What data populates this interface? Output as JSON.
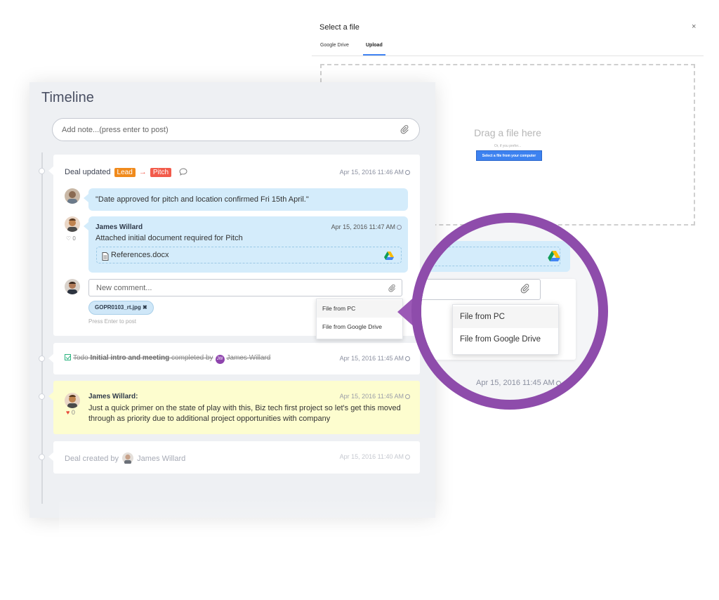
{
  "dialog": {
    "title": "Select a file",
    "close": "×",
    "tabs": [
      "Google Drive",
      "Upload"
    ],
    "drop_title": "Drag a file here",
    "drop_sub": "Or, if you prefer...",
    "drop_button": "Select a file from your computer"
  },
  "timeline": {
    "title": "Timeline",
    "note_placeholder": "Add note...(press enter to post)",
    "deal_update": {
      "prefix": "Deal updated",
      "from": "Lead",
      "arrow": "→",
      "to": "Pitch",
      "stamp": "Apr 15, 2016 11:46 AM"
    },
    "quote": "\"Date approved for pitch and location confirmed Fri 15th April.\"",
    "comment": {
      "author": "James Willard",
      "stamp": "Apr 15, 2016 11:47 AM",
      "message": "Attached initial document required for Pitch",
      "attachment": "References.docx",
      "likes": "0"
    },
    "new_comment": {
      "placeholder": "New comment...",
      "file_chip": "GOPR0103_rt.jpg",
      "hint": "Press Enter to post"
    },
    "upload_menu": [
      "File from PC",
      "File from Google Drive"
    ],
    "todo": {
      "prefix": "Todo",
      "title": "Initial intro and meeting",
      "middle": "completed by",
      "initials": "JW",
      "user": "James Willard",
      "stamp": "Apr 15, 2016 11:45 AM"
    },
    "note": {
      "author": "James Willard:",
      "stamp": "Apr 15, 2016 11:45 AM",
      "message": "Just a quick primer on the state of play with this, Biz tech first project so let's get this moved through as priority due to additional project opportunities with company",
      "likes": "0"
    },
    "created": {
      "prefix": "Deal created by",
      "user": "James Willard",
      "stamp": "Apr 15, 2016 11:40 AM"
    }
  },
  "magnifier": {
    "menu": [
      "File from PC",
      "File from Google Drive"
    ],
    "stamp": "Apr 15, 2016 11:45 AM"
  },
  "colors": {
    "accent_purple": "#8e4cab",
    "lead_orange": "#f08a1c",
    "pitch_red": "#f25b4b",
    "bubble_blue": "#d4ecfb",
    "note_yellow": "#fdfdcf",
    "upload_blue": "#3d82f0"
  }
}
